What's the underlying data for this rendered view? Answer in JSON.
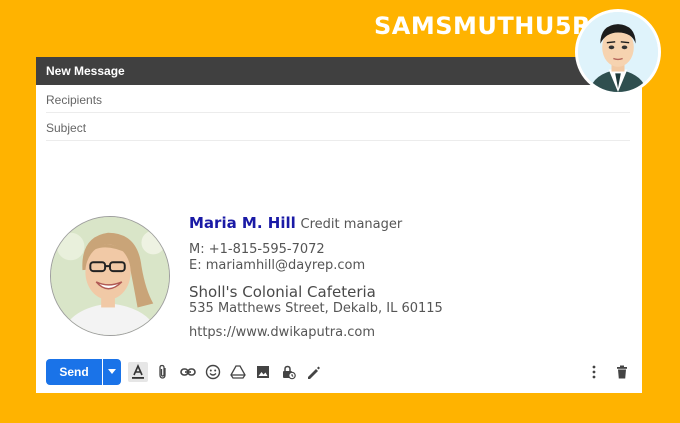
{
  "brand": "SAMSMUTHU5R",
  "window": {
    "title": "New Message",
    "recipients_placeholder": "Recipients",
    "subject_placeholder": "Subject"
  },
  "signature": {
    "name": "Maria M. Hill",
    "title": "Credit manager",
    "phone": "M: +1-815-595-7072",
    "email": "E: mariamhill@dayrep.com",
    "company": "Sholl's Colonial Cafeteria",
    "address": "535 Matthews Street, Dekalb, IL 60115",
    "website": "https://www.dwikaputra.com"
  },
  "toolbar": {
    "send_label": "Send",
    "icons": [
      "text-format-icon",
      "attach-icon",
      "link-icon",
      "emoji-icon",
      "drive-icon",
      "image-icon",
      "confidential-icon",
      "signature-icon"
    ],
    "right_icons": [
      "more-options-icon",
      "trash-icon"
    ]
  },
  "colors": {
    "background": "#FFB300",
    "titlebar": "#404040",
    "send_button": "#1a73e8",
    "signature_name": "#1a1aa6"
  }
}
